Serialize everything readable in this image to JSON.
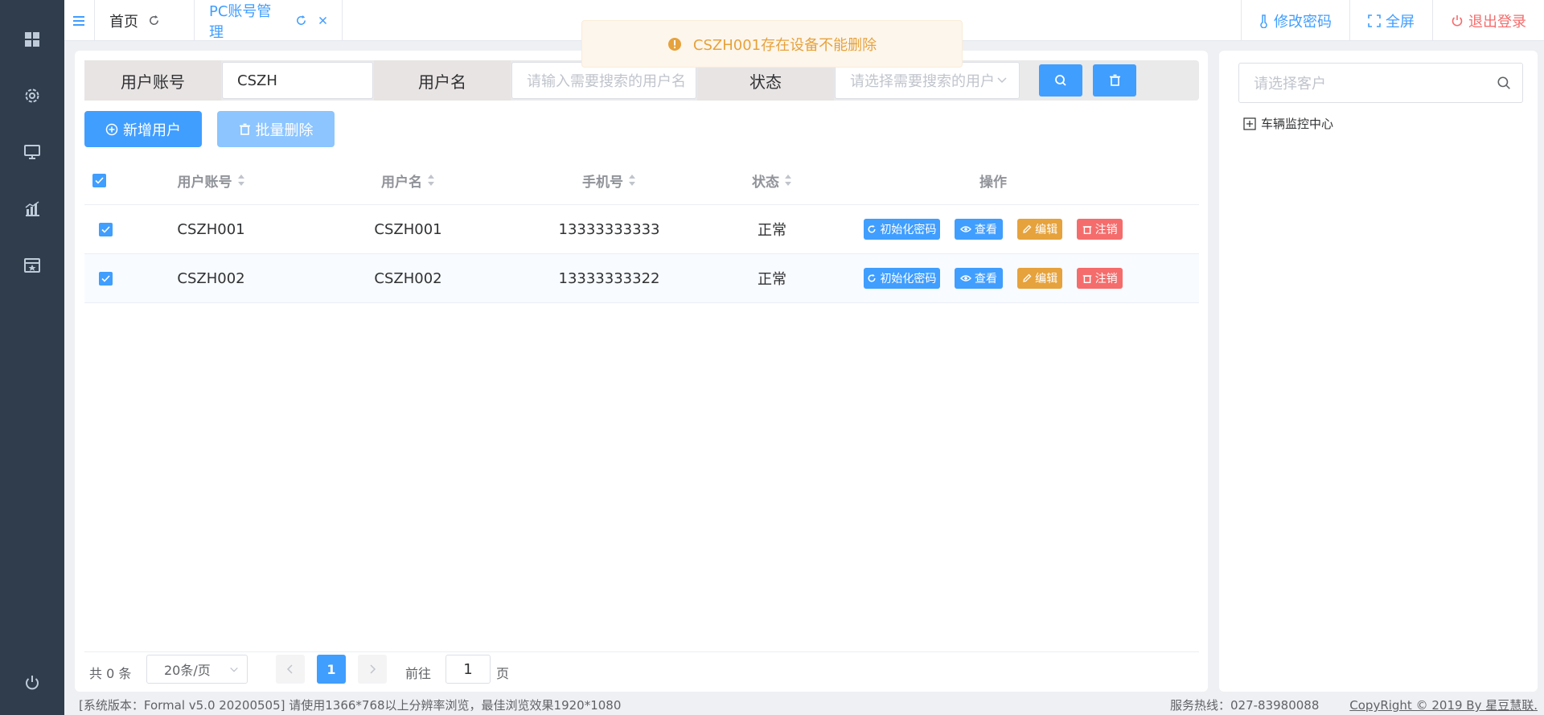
{
  "sidebar": {
    "icons": [
      "dashboard-icon",
      "settings-icon",
      "monitor-icon",
      "chart-icon",
      "calendar-icon",
      "power-icon"
    ]
  },
  "topbar": {
    "tabs": [
      {
        "label": "首页",
        "active": false
      },
      {
        "label": "PC账号管理",
        "active": true
      }
    ],
    "actions": {
      "change_password": "修改密码",
      "fullscreen": "全屏",
      "logout": "退出登录"
    }
  },
  "toast": {
    "message": "CSZH001存在设备不能删除",
    "type": "warning"
  },
  "search": {
    "account_label": "用户账号",
    "account_value": "CSZH",
    "username_label": "用户名",
    "username_placeholder": "请输入需要搜索的用户名",
    "status_label": "状态",
    "status_placeholder": "请选择需要搜索的用户"
  },
  "toolbar": {
    "add_user": "新增用户",
    "batch_delete": "批量删除"
  },
  "table": {
    "columns": [
      "用户账号",
      "用户名",
      "手机号",
      "状态",
      "操作"
    ],
    "rows": [
      {
        "account": "CSZH001",
        "username": "CSZH001",
        "phone": "13333333333",
        "status": "正常",
        "checked": true
      },
      {
        "account": "CSZH002",
        "username": "CSZH002",
        "phone": "13333333322",
        "status": "正常",
        "checked": true
      }
    ],
    "row_actions": {
      "reset": "初始化密码",
      "view": "查看",
      "edit": "编辑",
      "cancel": "注销"
    }
  },
  "pagination": {
    "total": "共 0 条",
    "page_size": "20条/页",
    "current_page": "1",
    "goto_label": "前往",
    "goto_value": "1",
    "page_suffix": "页"
  },
  "right_panel": {
    "customer_placeholder": "请选择客户",
    "tree_root": "车辆监控中心"
  },
  "footer": {
    "version": "[系统版本：Formal v5.0 20200505] 请使用1366*768以上分辨率浏览，最佳浏览效果1920*1080",
    "hotline": "服务热线：027-83980088",
    "copyright": "CopyRight © 2019 By 星豆慧联."
  },
  "colors": {
    "sidebar": "#2f3d4c",
    "primary": "#409eff",
    "warning": "#e6a23c",
    "danger": "#f56c6c"
  }
}
